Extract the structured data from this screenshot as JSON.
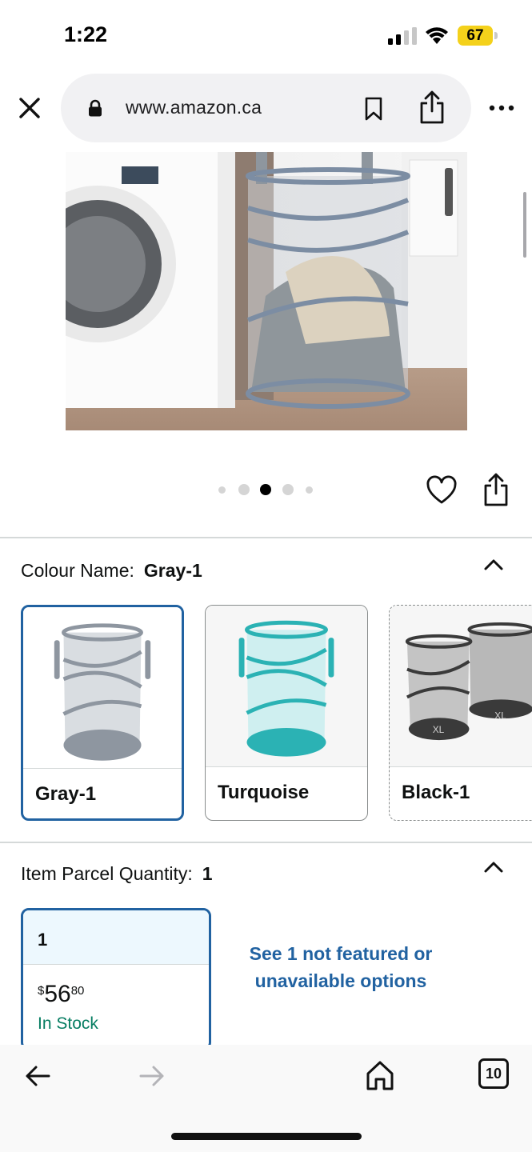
{
  "status_bar": {
    "time": "1:22",
    "battery": "67",
    "battery_color": "#f4d11b"
  },
  "browser": {
    "url": "www.amazon.ca",
    "icons": [
      "close-icon",
      "lock-icon",
      "bookmark-icon",
      "share-icon",
      "more-icon"
    ]
  },
  "gallery": {
    "image_count": 5,
    "active_index": 2,
    "icons": [
      "heart-icon",
      "share-icon"
    ]
  },
  "colour": {
    "label": "Colour Name:",
    "value": "Gray-1",
    "options": [
      {
        "label": "Gray-1",
        "selected": true,
        "color": "#8e96a0"
      },
      {
        "label": "Turquoise",
        "selected": false,
        "color": "#2bb2b4"
      },
      {
        "label": "Black-1",
        "selected": false,
        "color": "#3a3a3a",
        "unavailable": true,
        "badge": "XL"
      }
    ]
  },
  "quantity": {
    "label": "Item Parcel Quantity:",
    "value": "1",
    "option": {
      "label": "1",
      "price_symbol": "$",
      "price_whole": "56",
      "price_fraction": "80",
      "stock": "In Stock"
    },
    "see_more": "See 1 not featured or unavailable options"
  },
  "toolbar": {
    "tab_count": "10",
    "icons": [
      "back-arrow-icon",
      "forward-arrow-icon",
      "home-icon",
      "tabs-icon"
    ]
  },
  "colors": {
    "link": "#2162a1",
    "stock": "#067d62",
    "selected_border": "#2162a1"
  }
}
